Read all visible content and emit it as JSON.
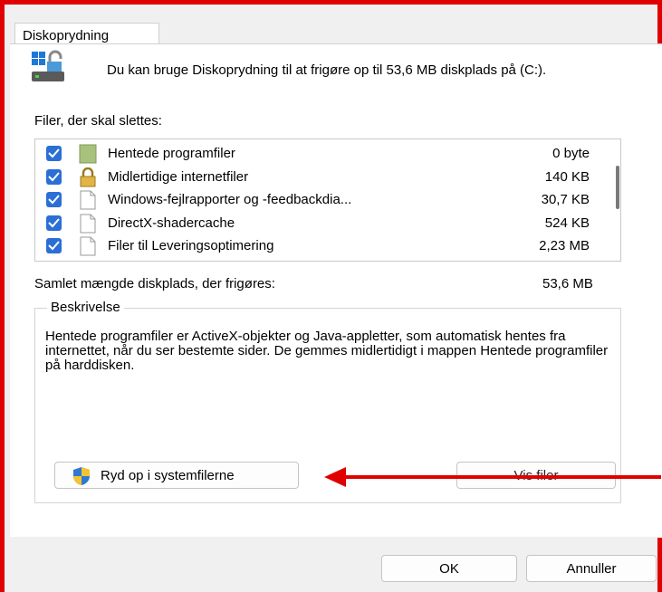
{
  "dialog": {
    "tab_label": "Diskoprydning",
    "intro_text": "Du kan bruge Diskoprydning til at frigøre op til 53,6 MB diskplads på  (C:).",
    "files_label": "Filer, der skal slettes:",
    "files": [
      {
        "name": "Hentede programfiler",
        "size": "0 byte",
        "checked": true,
        "icon": "green-folder-icon"
      },
      {
        "name": "Midlertidige internetfiler",
        "size": "140 KB",
        "checked": true,
        "icon": "lock-icon"
      },
      {
        "name": "Windows-fejlrapporter og -feedbackdia...",
        "size": "30,7 KB",
        "checked": true,
        "icon": "document-icon"
      },
      {
        "name": "DirectX-shadercache",
        "size": "524 KB",
        "checked": true,
        "icon": "document-icon"
      },
      {
        "name": "Filer til Leveringsoptimering",
        "size": "2,23 MB",
        "checked": true,
        "icon": "document-icon"
      }
    ],
    "total_label": "Samlet mængde diskplads, der frigøres:",
    "total_value": "53,6 MB",
    "description_title": "Beskrivelse",
    "description_text": "Hentede programfiler er ActiveX-objekter og Java-appletter, som automatisk hentes fra internettet, når du ser bestemte sider. De gemmes midlertidigt i mappen Hentede programfiler på harddisken.",
    "cleanup_button": "Ryd op i systemfilerne",
    "view_files_button": "Vis filer",
    "ok_button": "OK",
    "cancel_button": "Annuller"
  },
  "colors": {
    "annotation_red": "#e00000",
    "checkbox_blue": "#2b6fd6"
  }
}
